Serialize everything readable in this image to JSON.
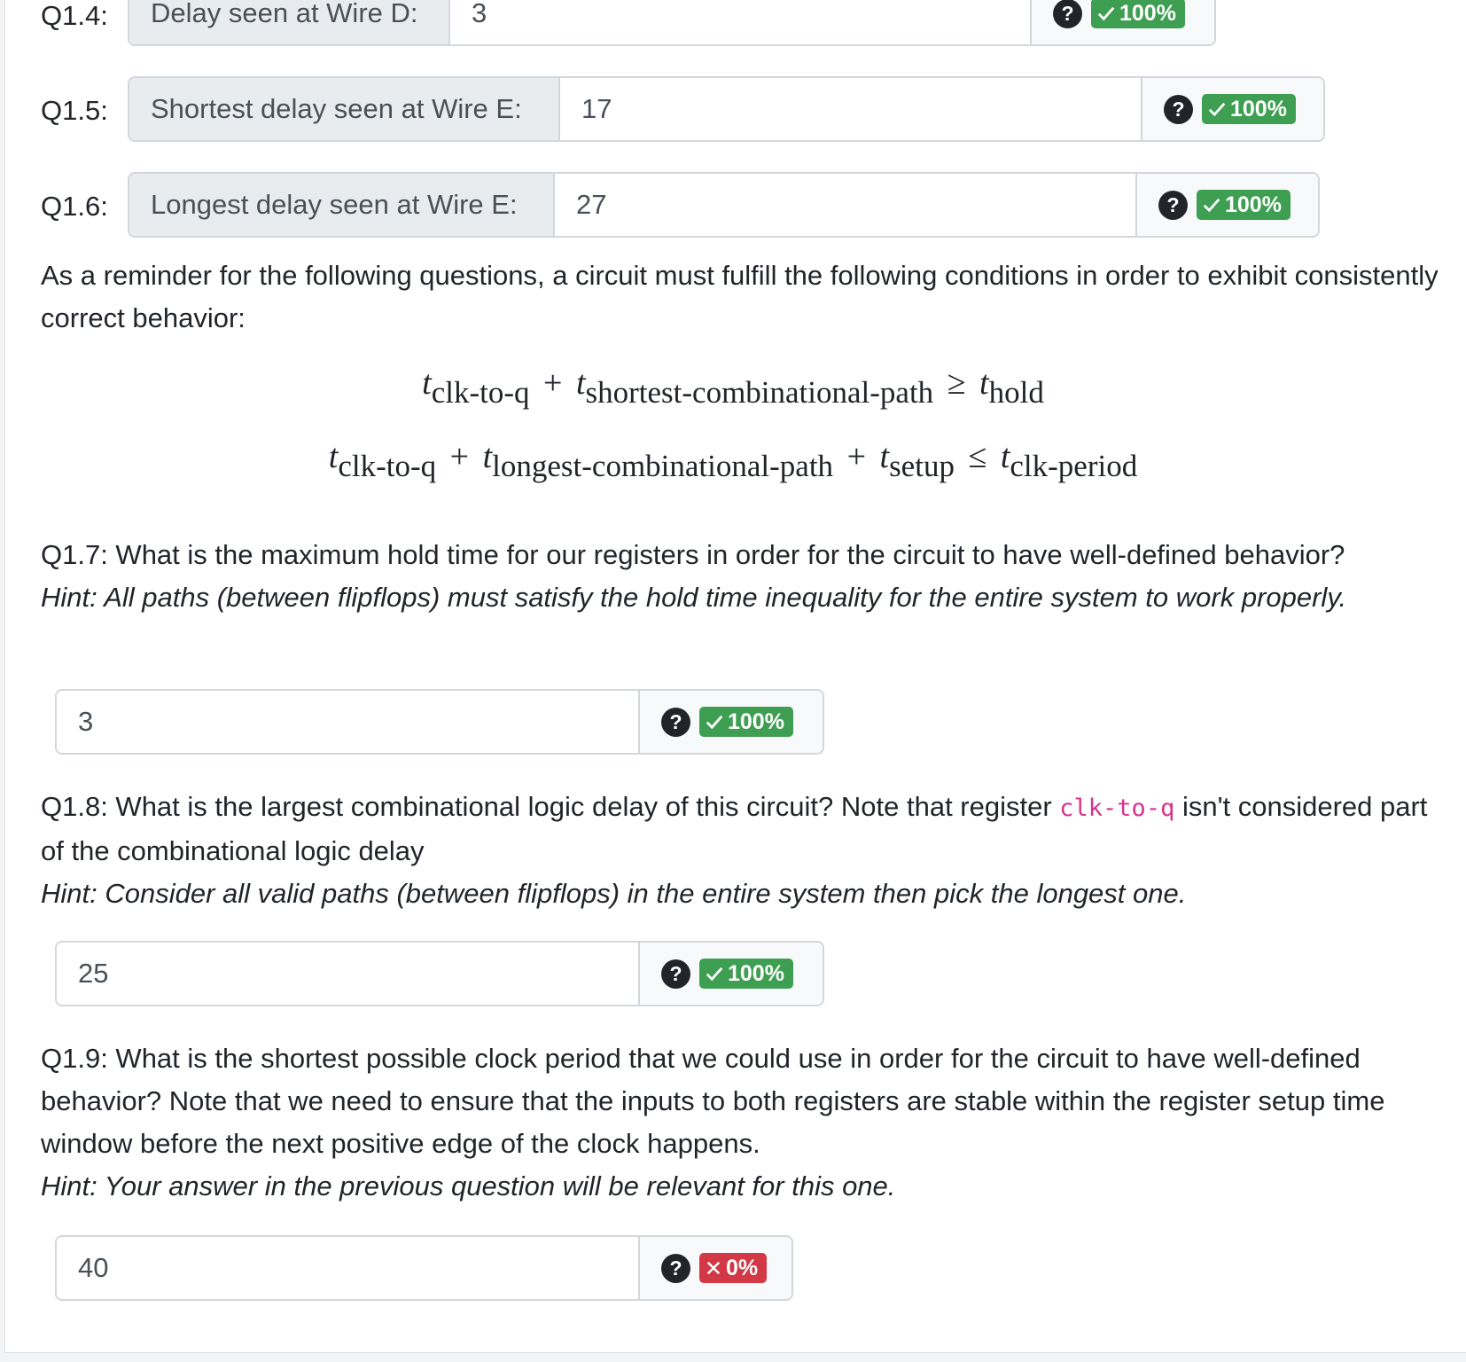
{
  "q14": {
    "label": "Q1.4:",
    "prefix": "Delay seen at Wire D:",
    "value": "3",
    "help": "?",
    "score": "100%"
  },
  "q15": {
    "label": "Q1.5:",
    "prefix": "Shortest delay seen at Wire E:",
    "value": "17",
    "help": "?",
    "score": "100%"
  },
  "q16": {
    "label": "Q1.6:",
    "prefix": "Longest delay seen at Wire E:",
    "value": "27",
    "help": "?",
    "score": "100%"
  },
  "reminder": "As a reminder for the following questions, a circuit must fulfill the following conditions in order to exhibit consistently correct behavior:",
  "eq1": {
    "t": "t",
    "s1": "clk-to-q",
    "op1": "+",
    "s2": "shortest-combinational-path",
    "op2": "≥",
    "s3": "hold"
  },
  "eq2": {
    "t": "t",
    "s1": "clk-to-q",
    "op1": "+",
    "s2": "longest-combinational-path",
    "op2": "+",
    "s3": "setup",
    "op3": "≤",
    "s4": "clk-period"
  },
  "q17": {
    "question": "Q1.7: What is the maximum hold time for our registers in order for the circuit to have well-defined behavior?",
    "hint": "Hint: All paths (between flipflops) must satisfy the hold time inequality for the entire system to work properly.",
    "value": "3",
    "help": "?",
    "score": "100%"
  },
  "q18": {
    "question_a": "Q1.8: What is the largest combinational logic delay of this circuit? Note that register ",
    "code": "clk-to-q",
    "question_b": " isn't considered part of the combinational logic delay",
    "hint": "Hint: Consider all valid paths (between flipflops) in the entire system then pick the longest one.",
    "value": "25",
    "help": "?",
    "score": "100%"
  },
  "q19": {
    "question": "Q1.9: What is the shortest possible clock period that we could use in order for the circuit to have well-defined behavior? Note that we need to ensure that the inputs to both registers are stable within the register setup time window before the next positive edge of the clock happens.",
    "hint": "Hint: Your answer in the previous question will be relevant for this one.",
    "value": "40",
    "help": "?",
    "score": "0%"
  },
  "colors": {
    "correct": "#3e9f52",
    "incorrect": "#d23845",
    "code": "#d6338c"
  },
  "icons": {
    "correct": "check-icon",
    "incorrect": "x-icon",
    "help": "question-circle-icon"
  }
}
